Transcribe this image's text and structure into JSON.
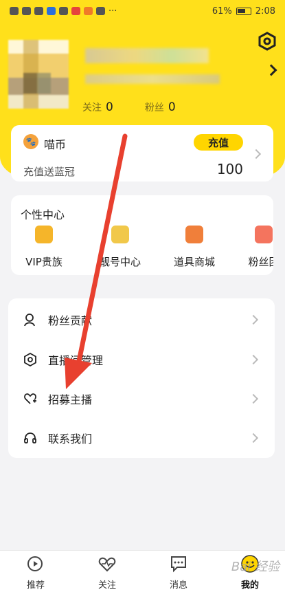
{
  "status_bar": {
    "battery_percent": "61%",
    "time": "2:08",
    "ellipsis": "···"
  },
  "profile": {
    "follow_label": "关注",
    "follow_count": "0",
    "fans_label": "粉丝",
    "fans_count": "0"
  },
  "coin_card": {
    "label": "喵币",
    "recharge_button": "充值",
    "promo_text": "充值送蓝冠",
    "amount": "100"
  },
  "personal_center": {
    "title": "个性中心",
    "items": [
      {
        "label": "VIP贵族",
        "icon": "crown-icon",
        "color": "#f5b52a"
      },
      {
        "label": "靓号中心",
        "icon": "badge-icon",
        "color": "#f1c84a"
      },
      {
        "label": "道具商城",
        "icon": "car-icon",
        "color": "#f07f3a"
      },
      {
        "label": "粉丝团",
        "icon": "heart-icon",
        "color": "#f4745e"
      }
    ]
  },
  "menu": {
    "items": [
      {
        "label": "粉丝贡献",
        "icon": "user-contribution-icon"
      },
      {
        "label": "直播间管理",
        "icon": "gear-icon"
      },
      {
        "label": "招募主播",
        "icon": "heart-plus-icon"
      },
      {
        "label": "联系我们",
        "icon": "headset-icon"
      }
    ]
  },
  "tabbar": {
    "items": [
      {
        "label": "推荐",
        "icon": "camera-icon",
        "active": false
      },
      {
        "label": "关注",
        "icon": "heart-pulse-icon",
        "active": false
      },
      {
        "label": "消息",
        "icon": "chat-icon",
        "active": false
      },
      {
        "label": "我的",
        "icon": "smiley-icon",
        "active": true
      }
    ]
  },
  "colors": {
    "brand_yellow": "#ffe01b",
    "button_yellow": "#ffd500",
    "annotation_red": "#e8402f"
  },
  "watermark": "Bai 经验"
}
